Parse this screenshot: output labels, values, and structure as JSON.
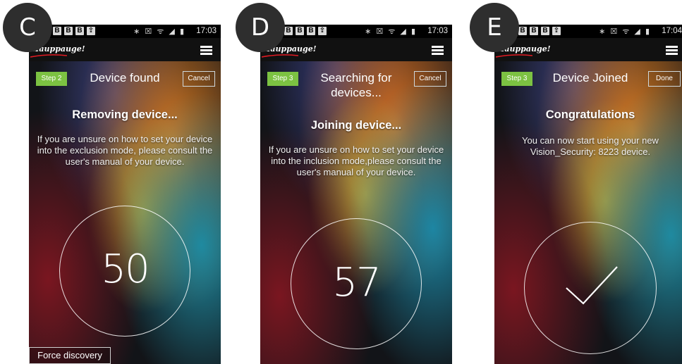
{
  "labels": [
    "C",
    "D",
    "E"
  ],
  "status": {
    "notifs": [
      "B",
      "B",
      "B",
      "⇪"
    ],
    "icons": "∗ ☒ ᯤ ◢ ▮",
    "times": [
      "17:03",
      "17:03",
      "17:04"
    ]
  },
  "logo_text": "Hauppauge!",
  "screens": [
    {
      "step": "Step 2",
      "title": "Device found",
      "action": "Cancel",
      "message_title": "Removing device...",
      "message_body": "If you are unsure on how to set your device into the exclusion mode, please consult the user's manual of your device.",
      "counter": "50",
      "progress_fraction": 0.55,
      "bottom_button": "Force discovery"
    },
    {
      "step": "Step 3",
      "title": "Searching for devices...",
      "action": "Cancel",
      "message_title": "Joining device...",
      "message_body": "If you are unsure on how to set your device into the inclusion mode,please consult the user's manual of your device.",
      "counter": "57",
      "progress_fraction": 0.62
    },
    {
      "step": "Step 3",
      "title": "Device Joined",
      "action": "Done",
      "message_title": "Congratulations",
      "message_body": "You can now start using your new Vision_Security: 8223 device."
    }
  ],
  "colors": {
    "step_green": "#7cc242",
    "label_bg": "#2e2e2e"
  }
}
